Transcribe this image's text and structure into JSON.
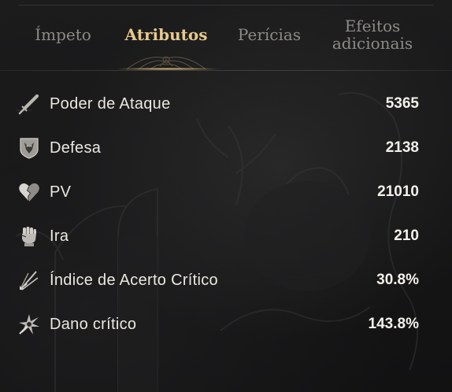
{
  "tabs": [
    {
      "id": "impeto",
      "label": "Ímpeto",
      "active": false
    },
    {
      "id": "atributos",
      "label": "Atributos",
      "active": true
    },
    {
      "id": "pericias",
      "label": "Perícias",
      "active": false
    },
    {
      "id": "efeitos",
      "label_line1": "Efeitos",
      "label_line2": "adicionais",
      "active": false
    }
  ],
  "stats": [
    {
      "icon": "sword-icon",
      "label": "Poder de Ataque",
      "value": "5365"
    },
    {
      "icon": "shield-icon",
      "label": "Defesa",
      "value": "2138"
    },
    {
      "icon": "heart-icon",
      "label": "PV",
      "value": "21010"
    },
    {
      "icon": "fist-icon",
      "label": "Ira",
      "value": "210"
    },
    {
      "icon": "critical-strike-icon",
      "label": "Índice de Acerto Crítico",
      "value": "30.8%"
    },
    {
      "icon": "critical-damage-icon",
      "label": "Dano crítico",
      "value": "143.8%"
    }
  ],
  "colors": {
    "active_tab": "#e7c98d",
    "inactive_tab": "#8d8a86",
    "text": "#ebe8e2",
    "background": "#161617"
  }
}
